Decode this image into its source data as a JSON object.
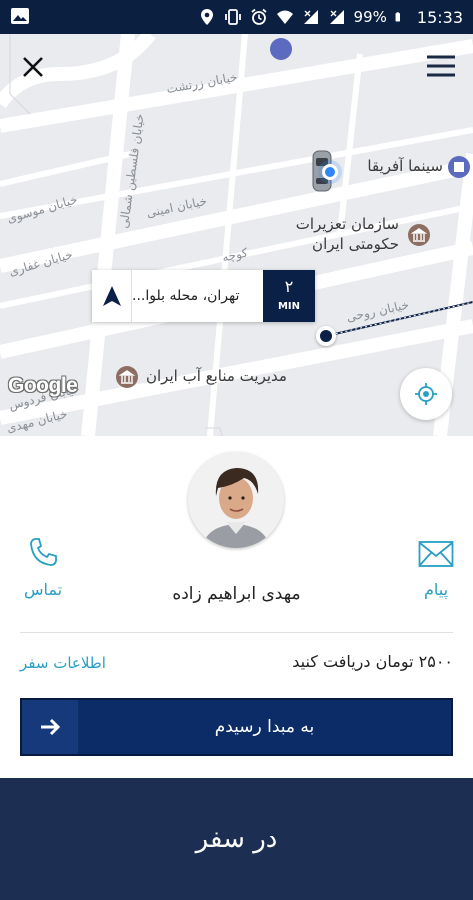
{
  "status_bar": {
    "battery": "99%",
    "time": "15:33"
  },
  "map": {
    "street_labels": [
      "خیابان زرتشت",
      "خیابان فلسطین شمالی",
      "خیابان موسوی",
      "خیابان امینی",
      "خیابان غفاری",
      "کوچه",
      "خیابان روحی",
      "خیابان فردوس",
      "خیابان مهدی"
    ],
    "pois": {
      "cinema": "سینما آفریقا",
      "org_line1": "سازمان تعزیرات",
      "org_line2": "حکومتی ایران",
      "water": "مدیریت منابع آب ایران"
    },
    "eta": {
      "address": "تهران، محله بلوا...",
      "minutes": "۲",
      "unit": "MIN"
    },
    "attribution": "Google"
  },
  "driver": {
    "name": "مهدی ابراهیم زاده",
    "call_label": "تماس",
    "message_label": "پیام"
  },
  "trip": {
    "fare_text": "۲۵۰۰ تومان دریافت کنید",
    "info_link": "اطلاعات سفر",
    "arrive_button": "به مبدا رسیدم"
  },
  "footer": {
    "status": "در سفر"
  },
  "colors": {
    "navy": "#0b2046",
    "accent": "#2a9fc4",
    "footer": "#1c2f52"
  }
}
